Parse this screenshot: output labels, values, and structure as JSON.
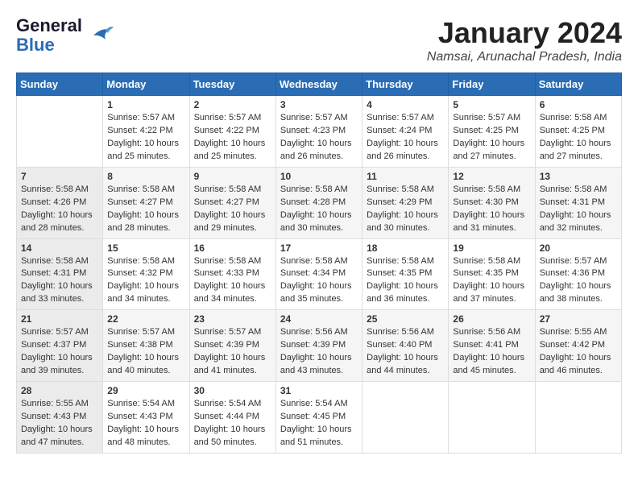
{
  "logo": {
    "line1": "General",
    "line2": "Blue"
  },
  "title": "January 2024",
  "subtitle": "Namsai, Arunachal Pradesh, India",
  "days": [
    "Sunday",
    "Monday",
    "Tuesday",
    "Wednesday",
    "Thursday",
    "Friday",
    "Saturday"
  ],
  "weeks": [
    [
      {
        "day": "",
        "content": ""
      },
      {
        "day": "1",
        "content": "Sunrise: 5:57 AM\nSunset: 4:22 PM\nDaylight: 10 hours\nand 25 minutes."
      },
      {
        "day": "2",
        "content": "Sunrise: 5:57 AM\nSunset: 4:22 PM\nDaylight: 10 hours\nand 25 minutes."
      },
      {
        "day": "3",
        "content": "Sunrise: 5:57 AM\nSunset: 4:23 PM\nDaylight: 10 hours\nand 26 minutes."
      },
      {
        "day": "4",
        "content": "Sunrise: 5:57 AM\nSunset: 4:24 PM\nDaylight: 10 hours\nand 26 minutes."
      },
      {
        "day": "5",
        "content": "Sunrise: 5:57 AM\nSunset: 4:25 PM\nDaylight: 10 hours\nand 27 minutes."
      },
      {
        "day": "6",
        "content": "Sunrise: 5:58 AM\nSunset: 4:25 PM\nDaylight: 10 hours\nand 27 minutes."
      }
    ],
    [
      {
        "day": "7",
        "content": "Sunrise: 5:58 AM\nSunset: 4:26 PM\nDaylight: 10 hours\nand 28 minutes."
      },
      {
        "day": "8",
        "content": "Sunrise: 5:58 AM\nSunset: 4:27 PM\nDaylight: 10 hours\nand 28 minutes."
      },
      {
        "day": "9",
        "content": "Sunrise: 5:58 AM\nSunset: 4:27 PM\nDaylight: 10 hours\nand 29 minutes."
      },
      {
        "day": "10",
        "content": "Sunrise: 5:58 AM\nSunset: 4:28 PM\nDaylight: 10 hours\nand 30 minutes."
      },
      {
        "day": "11",
        "content": "Sunrise: 5:58 AM\nSunset: 4:29 PM\nDaylight: 10 hours\nand 30 minutes."
      },
      {
        "day": "12",
        "content": "Sunrise: 5:58 AM\nSunset: 4:30 PM\nDaylight: 10 hours\nand 31 minutes."
      },
      {
        "day": "13",
        "content": "Sunrise: 5:58 AM\nSunset: 4:31 PM\nDaylight: 10 hours\nand 32 minutes."
      }
    ],
    [
      {
        "day": "14",
        "content": "Sunrise: 5:58 AM\nSunset: 4:31 PM\nDaylight: 10 hours\nand 33 minutes."
      },
      {
        "day": "15",
        "content": "Sunrise: 5:58 AM\nSunset: 4:32 PM\nDaylight: 10 hours\nand 34 minutes."
      },
      {
        "day": "16",
        "content": "Sunrise: 5:58 AM\nSunset: 4:33 PM\nDaylight: 10 hours\nand 34 minutes."
      },
      {
        "day": "17",
        "content": "Sunrise: 5:58 AM\nSunset: 4:34 PM\nDaylight: 10 hours\nand 35 minutes."
      },
      {
        "day": "18",
        "content": "Sunrise: 5:58 AM\nSunset: 4:35 PM\nDaylight: 10 hours\nand 36 minutes."
      },
      {
        "day": "19",
        "content": "Sunrise: 5:58 AM\nSunset: 4:35 PM\nDaylight: 10 hours\nand 37 minutes."
      },
      {
        "day": "20",
        "content": "Sunrise: 5:57 AM\nSunset: 4:36 PM\nDaylight: 10 hours\nand 38 minutes."
      }
    ],
    [
      {
        "day": "21",
        "content": "Sunrise: 5:57 AM\nSunset: 4:37 PM\nDaylight: 10 hours\nand 39 minutes."
      },
      {
        "day": "22",
        "content": "Sunrise: 5:57 AM\nSunset: 4:38 PM\nDaylight: 10 hours\nand 40 minutes."
      },
      {
        "day": "23",
        "content": "Sunrise: 5:57 AM\nSunset: 4:39 PM\nDaylight: 10 hours\nand 41 minutes."
      },
      {
        "day": "24",
        "content": "Sunrise: 5:56 AM\nSunset: 4:39 PM\nDaylight: 10 hours\nand 43 minutes."
      },
      {
        "day": "25",
        "content": "Sunrise: 5:56 AM\nSunset: 4:40 PM\nDaylight: 10 hours\nand 44 minutes."
      },
      {
        "day": "26",
        "content": "Sunrise: 5:56 AM\nSunset: 4:41 PM\nDaylight: 10 hours\nand 45 minutes."
      },
      {
        "day": "27",
        "content": "Sunrise: 5:55 AM\nSunset: 4:42 PM\nDaylight: 10 hours\nand 46 minutes."
      }
    ],
    [
      {
        "day": "28",
        "content": "Sunrise: 5:55 AM\nSunset: 4:43 PM\nDaylight: 10 hours\nand 47 minutes."
      },
      {
        "day": "29",
        "content": "Sunrise: 5:54 AM\nSunset: 4:43 PM\nDaylight: 10 hours\nand 48 minutes."
      },
      {
        "day": "30",
        "content": "Sunrise: 5:54 AM\nSunset: 4:44 PM\nDaylight: 10 hours\nand 50 minutes."
      },
      {
        "day": "31",
        "content": "Sunrise: 5:54 AM\nSunset: 4:45 PM\nDaylight: 10 hours\nand 51 minutes."
      },
      {
        "day": "",
        "content": ""
      },
      {
        "day": "",
        "content": ""
      },
      {
        "day": "",
        "content": ""
      }
    ]
  ]
}
